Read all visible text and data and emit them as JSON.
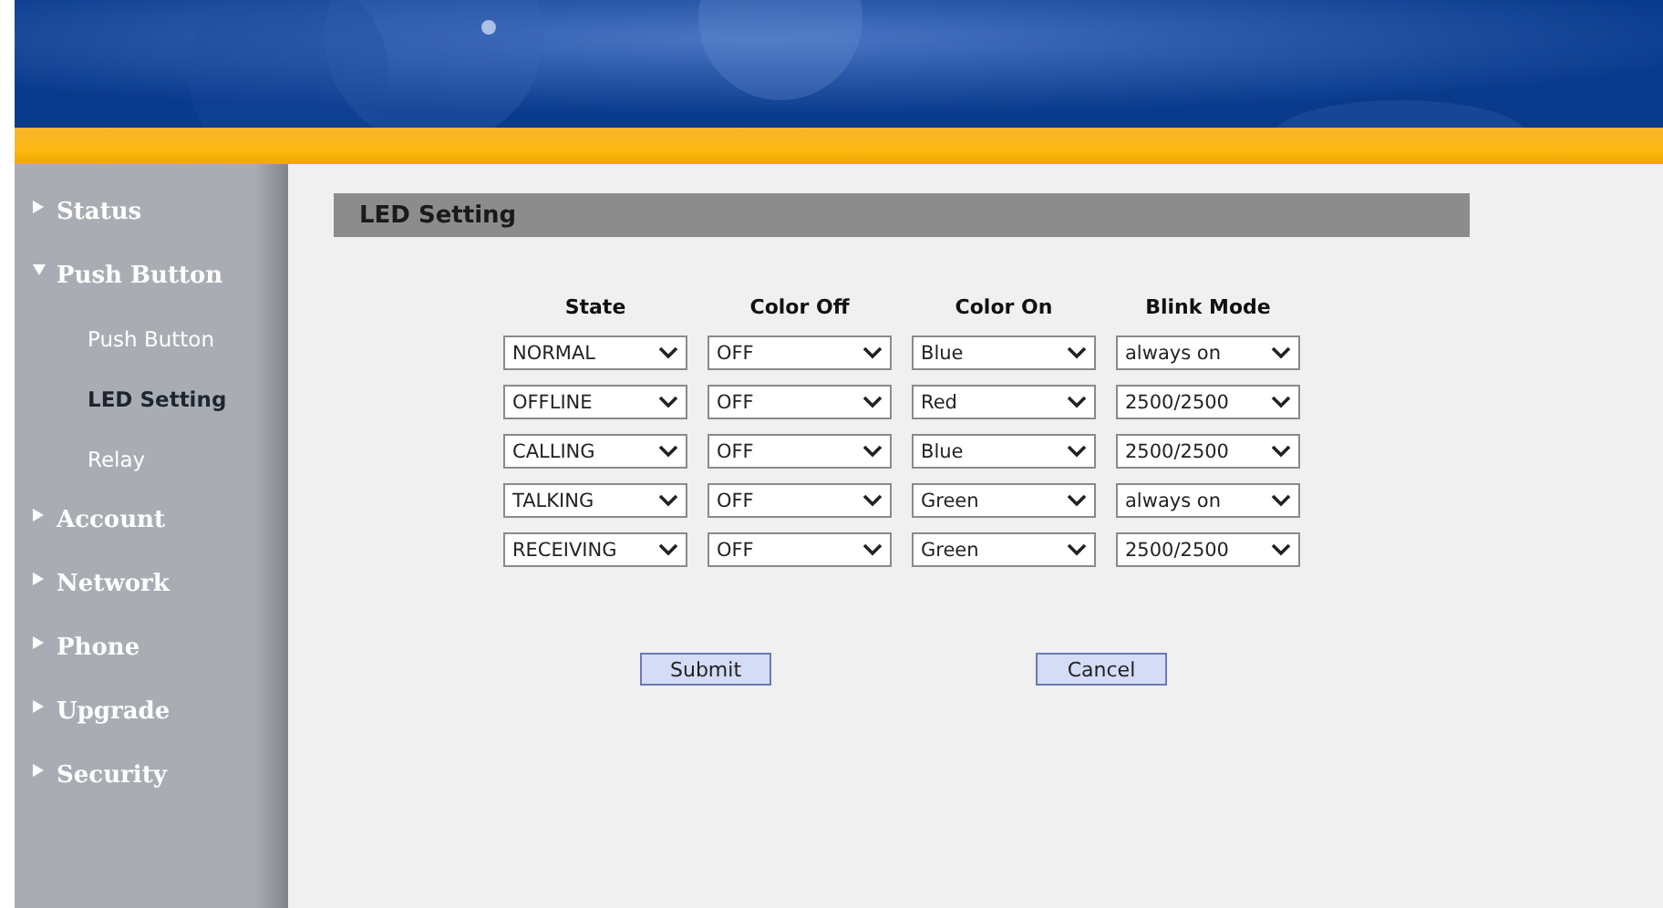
{
  "sidebar": {
    "items": [
      {
        "label": "Status",
        "expanded": false
      },
      {
        "label": "Push Button",
        "expanded": true,
        "children": [
          {
            "label": "Push Button",
            "selected": false
          },
          {
            "label": "LED Setting",
            "selected": true
          },
          {
            "label": "Relay",
            "selected": false
          }
        ]
      },
      {
        "label": "Account",
        "expanded": false
      },
      {
        "label": "Network",
        "expanded": false
      },
      {
        "label": "Phone",
        "expanded": false
      },
      {
        "label": "Upgrade",
        "expanded": false
      },
      {
        "label": "Security",
        "expanded": false
      }
    ]
  },
  "section": {
    "title": "LED Setting"
  },
  "table": {
    "columns": [
      "State",
      "Color Off",
      "Color On",
      "Blink Mode"
    ],
    "rows": [
      [
        "NORMAL",
        "OFF",
        "Blue",
        "always on"
      ],
      [
        "OFFLINE",
        "OFF",
        "Red",
        "2500/2500"
      ],
      [
        "CALLING",
        "OFF",
        "Blue",
        "2500/2500"
      ],
      [
        "TALKING",
        "OFF",
        "Green",
        "always on"
      ],
      [
        "RECEIVING",
        "OFF",
        "Green",
        "2500/2500"
      ]
    ]
  },
  "buttons": [
    "Submit",
    "Cancel"
  ]
}
